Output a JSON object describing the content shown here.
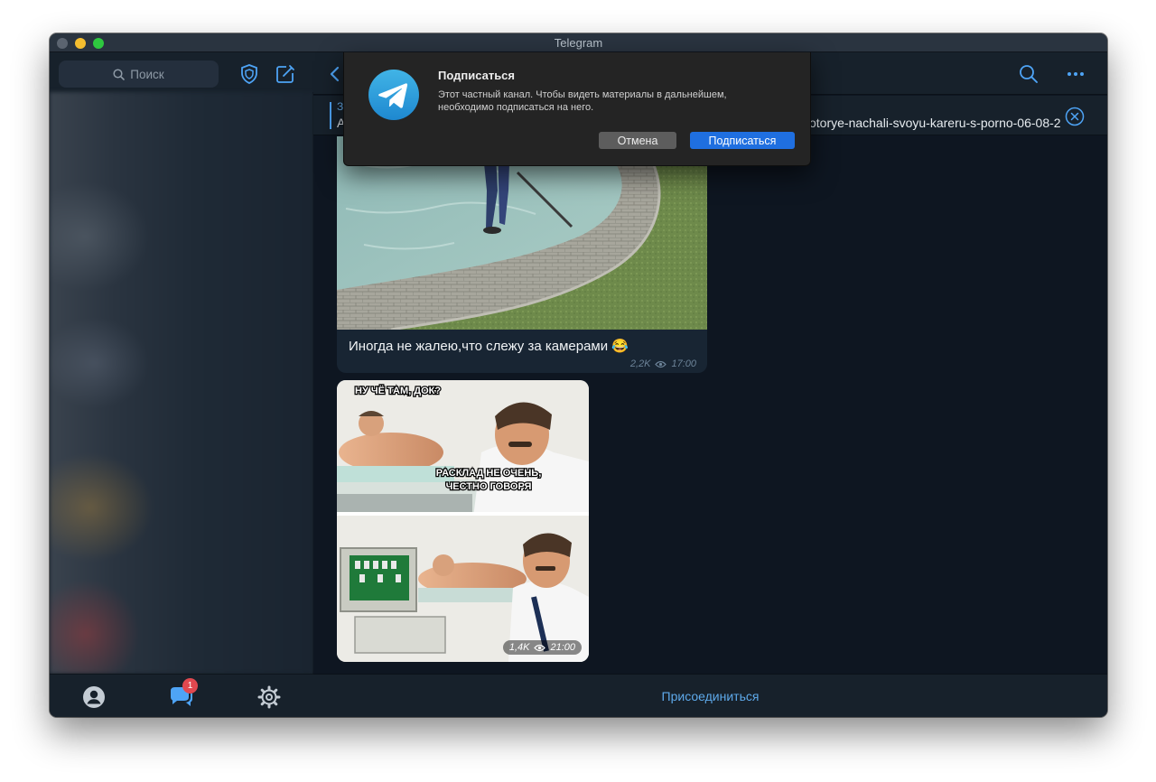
{
  "window": {
    "title": "Telegram"
  },
  "sidebar": {
    "search_placeholder": "Поиск",
    "bottom_nav": {
      "unread_badge": "1"
    }
  },
  "pinned": {
    "title": "З",
    "text_left": "А",
    "text_right": "otorye-nachali-svoyu-kareru-s-porno-06-08-2"
  },
  "messages": [
    {
      "type": "photo",
      "caption": "Иногда не жалею,что слежу за камерами",
      "caption_emoji": "😂",
      "views": "2,2K",
      "time": "17:00"
    },
    {
      "type": "meme",
      "top_text": "НУ ЧЁ ТАМ, ДОК?",
      "middle_text_line1": "РАСКЛАД НЕ ОЧЕНЬ,",
      "middle_text_line2": "ЧЕСТНО ГОВОРЯ",
      "views": "1,4K",
      "time": "21:00"
    }
  ],
  "join_bar": {
    "label": "Присоединиться"
  },
  "dialog": {
    "title": "Подписаться",
    "message": "Этот частный канал. Чтобы видеть материалы в дальнейшем, необходимо подписаться на него.",
    "cancel_label": "Отмена",
    "confirm_label": "Подписаться"
  },
  "colors": {
    "accent": "#5ea9ea",
    "dialog_confirm": "#1f6fe0",
    "badge": "#e0484f"
  },
  "icons": [
    "search-icon",
    "shield-icon",
    "compose-icon",
    "back-arrow-icon",
    "more-icon",
    "close-circle-icon",
    "eye-icon",
    "profile-icon",
    "chats-icon",
    "settings-gear-icon",
    "telegram-logo-icon"
  ]
}
